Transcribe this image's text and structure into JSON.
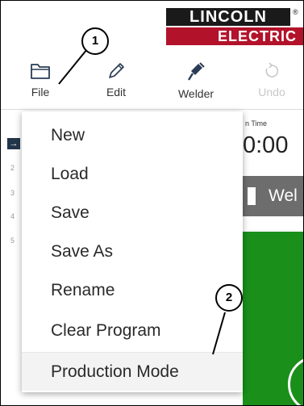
{
  "logo": {
    "top": "LINCOLN",
    "bottom": "ELECTRIC",
    "reg": "®"
  },
  "toolbar": {
    "file": {
      "label": "File",
      "icon": "folder-icon"
    },
    "edit": {
      "label": "Edit",
      "icon": "pencil-icon"
    },
    "welder": {
      "label": "Welder",
      "icon": "welding-torch-icon"
    },
    "undo": {
      "label": "Undo",
      "icon": "undo-icon",
      "disabled": true
    }
  },
  "background": {
    "time_label": "n Time",
    "time_value": "0:00",
    "weld_text": "Wel",
    "row_numbers": [
      "2",
      "3",
      "4",
      "5"
    ],
    "arrow": "→",
    "colors": {
      "weld_bar": "#6d6d6d",
      "green": "#1a8f1a",
      "marker": "#23374a"
    }
  },
  "menu": {
    "items": [
      {
        "label": "New"
      },
      {
        "label": "Load"
      },
      {
        "label": "Save"
      },
      {
        "label": "Save As"
      },
      {
        "label": "Rename"
      },
      {
        "label": "Clear Program"
      },
      {
        "label": "Production Mode",
        "highlighted": true
      }
    ]
  },
  "callouts": [
    "1",
    "2"
  ]
}
